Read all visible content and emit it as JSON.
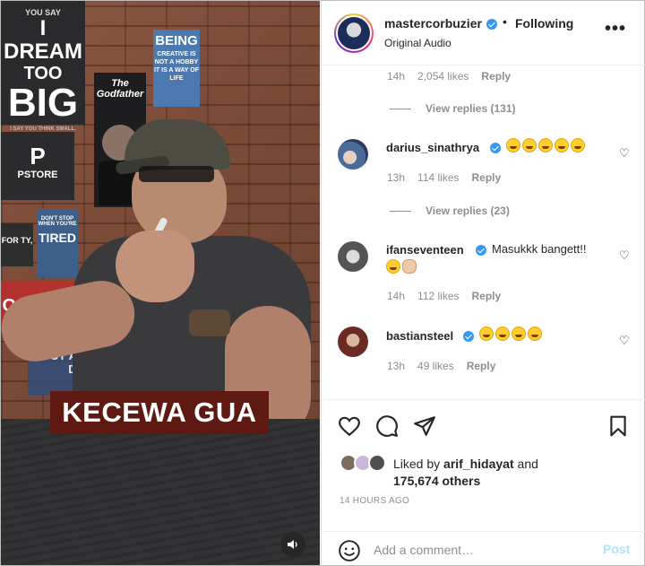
{
  "video": {
    "caption": "KECEWA GUA",
    "poster_texts": {
      "dream_line1": "YOU SAY",
      "dream_line2": "I DREAM",
      "dream_line3": "TOO",
      "dream_line4": "BIG",
      "dream_line5": "I SAY YOU THINK SMALL.",
      "being_title": "BEING",
      "being_body": "CREATIVE IS NOT A HOBBY IT IS A WAY OF LIFE",
      "godfather": "The Godfather",
      "pstore_logo": "P",
      "pstore_name": "PSTORE",
      "tired_small": "DON'T STOP WHEN YOU'RE",
      "tired_big": "TIRED",
      "small_left": "FOR TY,",
      "positive": "OSITIVE",
      "about": "BOUT A N JUST DO"
    },
    "sound_icon": "speaker-icon"
  },
  "header": {
    "username": "mastercorbuzier",
    "separator": "•",
    "follow_status": "Following",
    "audio": "Original Audio",
    "more_icon": "•••"
  },
  "comments": {
    "top_meta": {
      "time": "14h",
      "likes": "2,054 likes",
      "reply": "Reply"
    },
    "view_replies_1": "View replies (131)",
    "items": [
      {
        "username": "darius_sinathrya",
        "verified": true,
        "text": "",
        "emoji_count": 5,
        "time": "13h",
        "likes": "114 likes",
        "reply": "Reply"
      },
      {
        "username": "ifanseventeen",
        "verified": true,
        "text": "Masukkk bangett!!",
        "emoji_count": 2,
        "time": "14h",
        "likes": "112 likes",
        "reply": "Reply"
      },
      {
        "username": "bastiansteel",
        "verified": true,
        "text": "",
        "emoji_count": 4,
        "time": "13h",
        "likes": "49 likes",
        "reply": "Reply"
      }
    ],
    "view_replies_2": "View replies (23)"
  },
  "actions": {
    "liked_by_prefix": "Liked by",
    "liked_by_user": "arif_hidayat",
    "liked_by_and": "and",
    "liked_by_others": "175,674 others",
    "timestamp": "14 HOURS AGO"
  },
  "add_comment": {
    "placeholder": "Add a comment…",
    "post_label": "Post"
  },
  "colors": {
    "verified_blue": "#3897f0",
    "post_disabled": "#b2dffc",
    "caption_bg": "#5e1a12",
    "meta_gray": "#8e8e8e"
  }
}
